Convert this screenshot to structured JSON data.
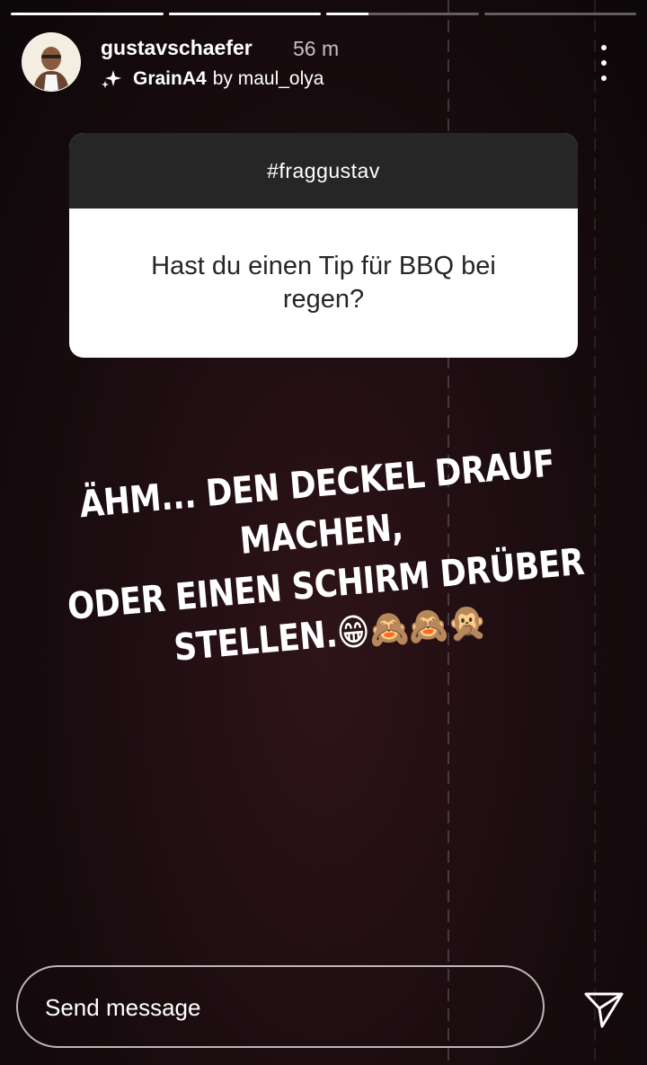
{
  "story": {
    "progress": [
      1.0,
      1.0,
      0.28,
      0.0
    ]
  },
  "header": {
    "username": "gustavschaefer",
    "time": "56 m",
    "filter_name": "GrainA4",
    "filter_by": "by maul_olya",
    "icons": {
      "filter": "sparkle-icon",
      "more": "more-vertical-icon"
    }
  },
  "question": {
    "hashtag": "#fraggustav",
    "text": "Hast du einen Tip für BBQ bei regen?"
  },
  "caption": {
    "line1": "ÄHM... DEN DECKEL DRAUF MACHEN,",
    "line2": "ODER EINEN SCHIRM DRÜBER",
    "line3": "STELLEN.",
    "emojis": "😁🙈🙈🙊"
  },
  "footer": {
    "message_placeholder": "Send message",
    "send_icon": "send-icon"
  },
  "colors": {
    "question_header": "#262626",
    "question_text": "#262626",
    "background": "#1d0d11"
  }
}
